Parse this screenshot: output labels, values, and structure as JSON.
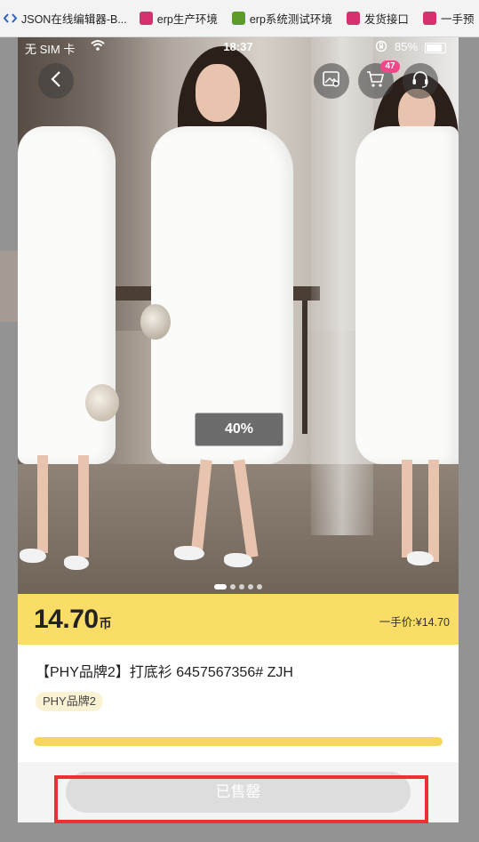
{
  "bookmarks": [
    {
      "label": "JSON在线编辑器-B...",
      "icon": "code-icon",
      "color": "#2b62c9"
    },
    {
      "label": "erp生产环境",
      "icon": "app-icon",
      "color": "#d6306e"
    },
    {
      "label": "erp系统测试环境",
      "icon": "leaf-icon",
      "color": "#5a9b2a"
    },
    {
      "label": "发货接口",
      "icon": "app-icon",
      "color": "#d6306e"
    },
    {
      "label": "一手预",
      "icon": "app-icon",
      "color": "#d6306e"
    }
  ],
  "status_bar": {
    "carrier": "无 SIM 卡",
    "time": "18:37",
    "battery": "85%"
  },
  "cart": {
    "badge": "47"
  },
  "gallery": {
    "progress_text": "40%",
    "dots_total": 5,
    "dots_active_index": 0
  },
  "price": {
    "value": "14.70",
    "unit": "币",
    "original_label": "一手价:¥14.70"
  },
  "product": {
    "title": "【PHY品牌2】打底衫 6457567356# ZJH",
    "brand_tag": "PHY品牌2",
    "stock_fraction": 1.0
  },
  "actions": {
    "sold_out_label": "已售罄"
  },
  "colors": {
    "accent_yellow": "#f9dd66",
    "badge_pink": "#f0468a",
    "highlight_red": "#ef2f33"
  }
}
